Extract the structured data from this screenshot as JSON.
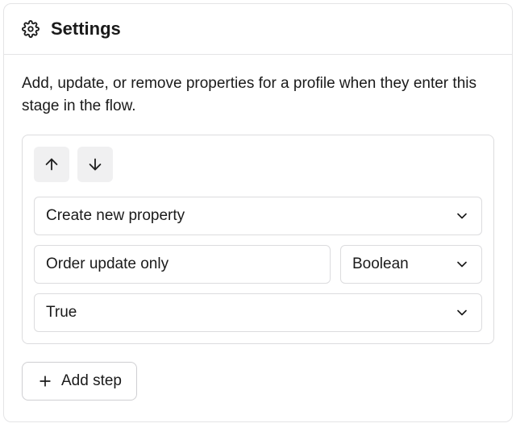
{
  "header": {
    "title": "Settings"
  },
  "description": "Add, update, or remove properties for a profile when they enter this stage in the flow.",
  "step": {
    "action_select": "Create new property",
    "property_name": "Order update only",
    "type_select": "Boolean",
    "value_select": "True"
  },
  "buttons": {
    "add_step": "Add step"
  }
}
